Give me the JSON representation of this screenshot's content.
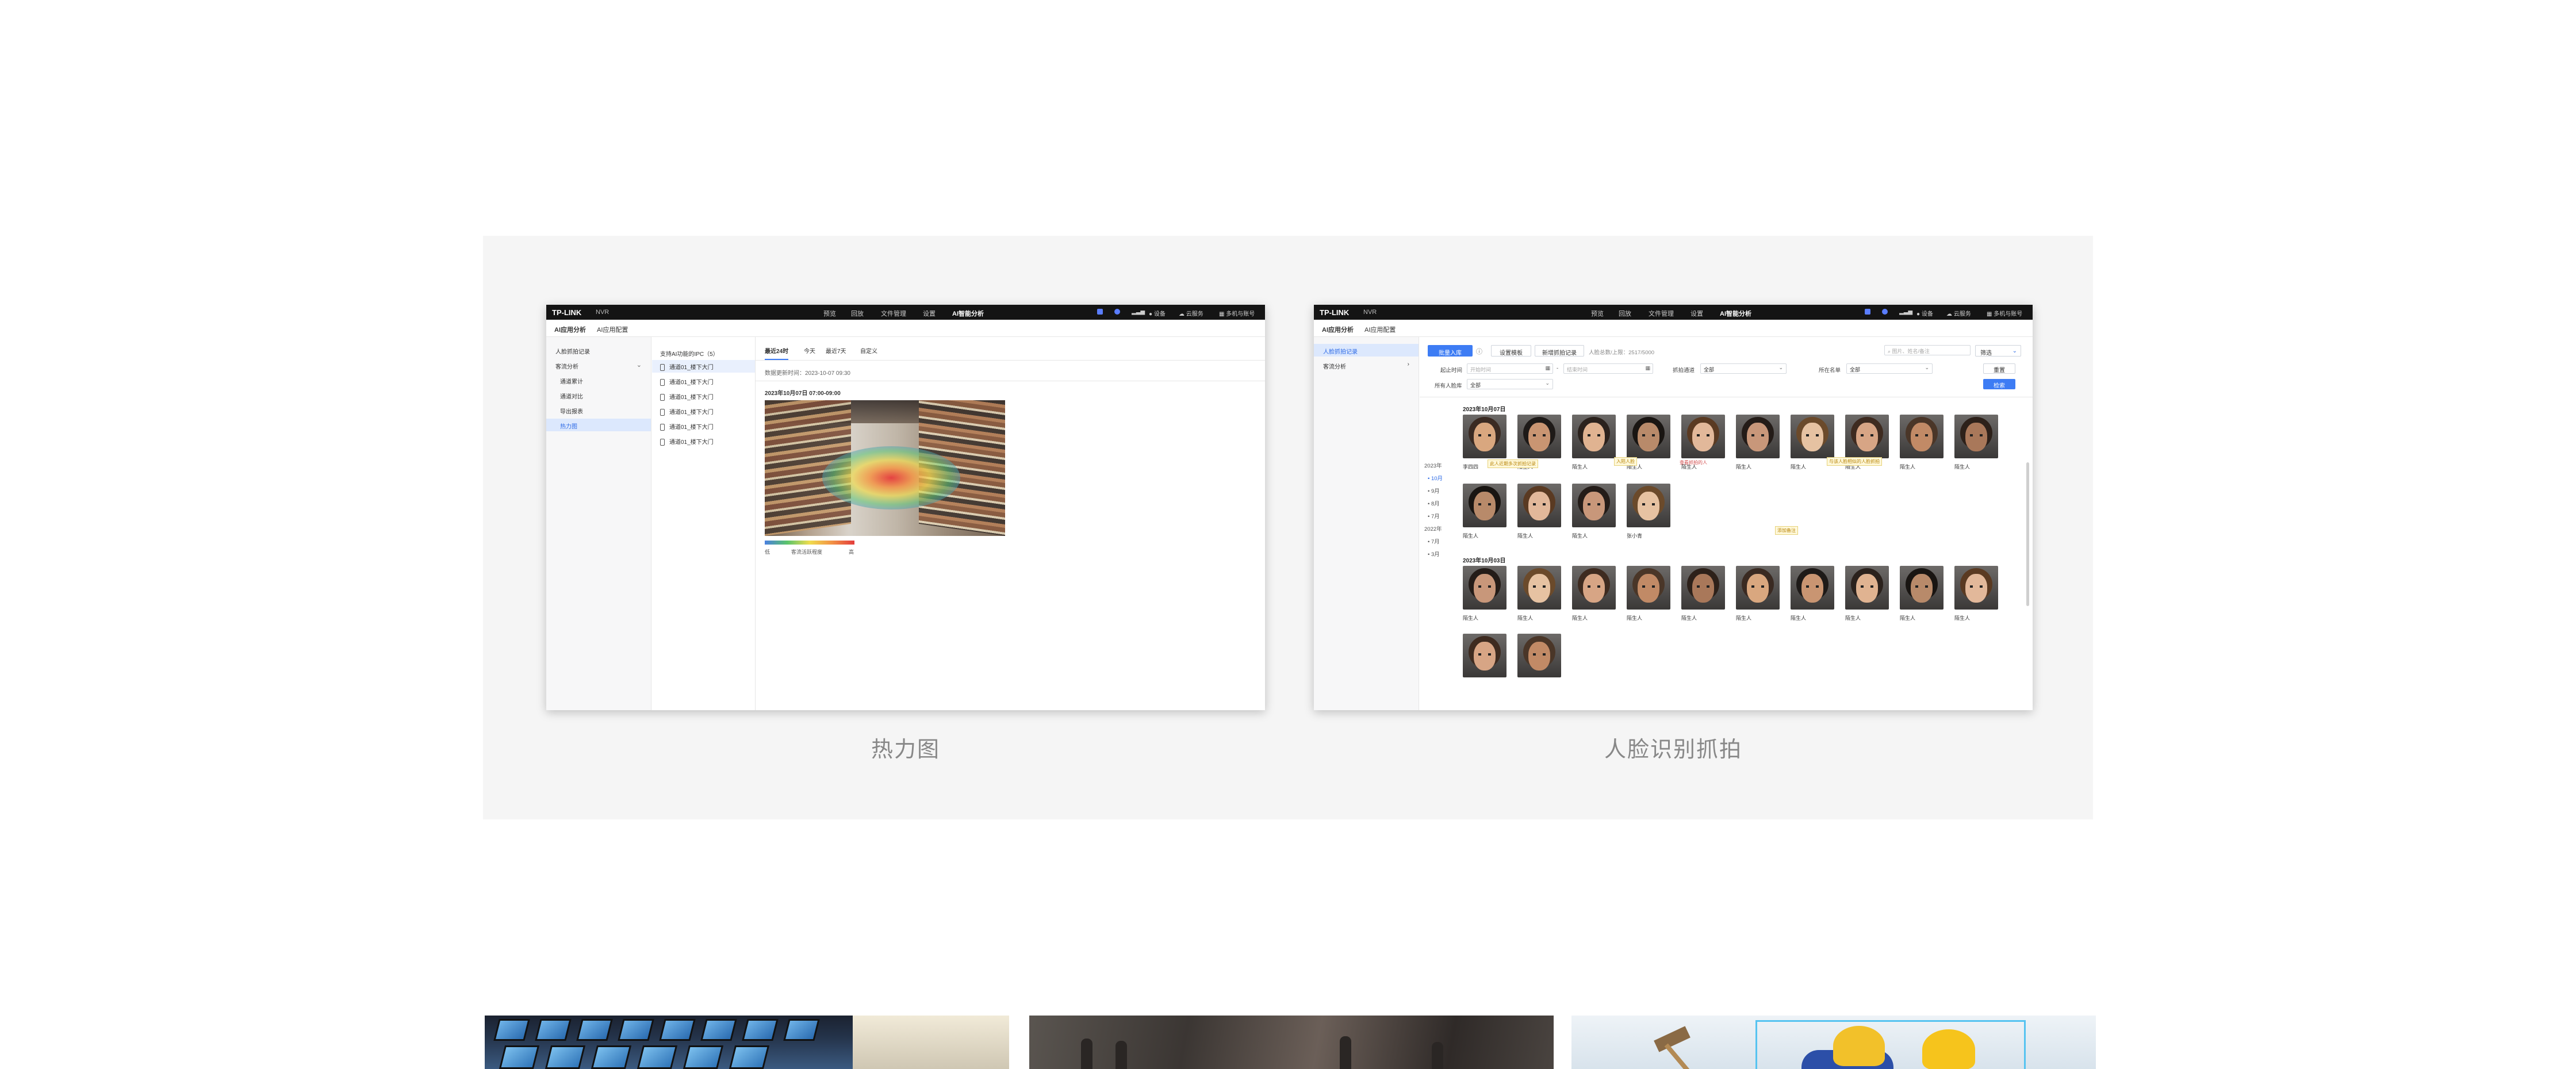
{
  "app": {
    "logo": "TP-LINK",
    "product": "NVR",
    "nav": [
      "预览",
      "回放",
      "文件管理",
      "设置",
      "AI智能分析"
    ],
    "nav_active": "AI智能分析",
    "right": [
      "设备",
      "云服务",
      "多机与账号"
    ],
    "subtabs": [
      "AI应用分析",
      "AI应用配置"
    ]
  },
  "heatmap_card": {
    "sidebar": [
      "人脸抓拍记录",
      "客流分析",
      "通道累计",
      "通道对比",
      "导出报表",
      "热力图"
    ],
    "sidebar_selected": "热力图",
    "channel_header": "支持AI功能的IPC（5）",
    "channels": [
      "通道01_楼下大门",
      "通道01_楼下大门",
      "通道01_楼下大门",
      "通道01_楼下大门",
      "通道01_楼下大门",
      "通道01_楼下大门"
    ],
    "tabs": [
      "最近24时",
      "今天",
      "最近7天",
      "自定义"
    ],
    "tab_active": "最近24时",
    "update_text": "数据更新时间：2023-10-07 09:30",
    "image_title": "2023年10月07日 07:00-09:00",
    "legend_low": "低",
    "legend_mid": "客流活跃程度",
    "legend_high": "高",
    "caption": "热力图"
  },
  "face_card": {
    "sidebar": [
      "人脸抓拍记录",
      "客流分析"
    ],
    "sidebar_selected": "人脸抓拍记录",
    "buttons": {
      "add": "批量入库",
      "settings": "设置模板",
      "clear": "新增抓拍记录",
      "filter": "筛选",
      "reset": "重置",
      "search": "检索"
    },
    "count_text": "人脸总数/上限：2517/5000",
    "search_placeholder": "图片、姓名/备注",
    "filters": {
      "start_label": "起止时间",
      "start_placeholder": "开始时间",
      "end_placeholder": "结束时间",
      "channel_label": "抓拍通道",
      "channel_value": "全部",
      "list_label": "所在名单",
      "list_value": "全部",
      "person_label": "所有人脸库",
      "person_value": "全部"
    },
    "timeline": [
      "2023年",
      "10月",
      "9月",
      "8月",
      "7月",
      "2022年",
      "7月",
      "3月"
    ],
    "timeline_selected": "10月",
    "group1_date": "2023年10月07日",
    "group2_date": "2023年10月03日",
    "row1_labels": [
      "李四四",
      "陌生人",
      "陌生人",
      "陌生人",
      "陌生人",
      "陌生人",
      "陌生人",
      "陌生人",
      "陌生人",
      "陌生人"
    ],
    "row2_labels": [
      "陌生人",
      "陌生人",
      "陌生人",
      "张小青"
    ],
    "row3_labels": [
      "陌生人",
      "陌生人",
      "陌生人",
      "陌生人",
      "陌生人",
      "陌生人",
      "陌生人",
      "陌生人",
      "陌生人",
      "陌生人"
    ],
    "tip1": "此人近期多次抓拍记录",
    "tip2": "入陌人脸",
    "tip3": "查看抓拍的人",
    "tip4": "与该人脸相似的人脸抓拍",
    "tip5": "添加备注",
    "caption": "人脸识别抓拍"
  }
}
